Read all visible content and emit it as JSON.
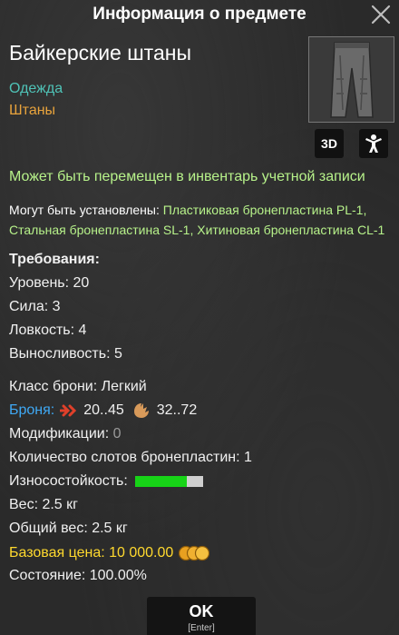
{
  "window": {
    "title": "Информация о предмете"
  },
  "item": {
    "name": "Байкерские штаны",
    "category": "Одежда",
    "subcategory": "Штаны",
    "thumbnail_icon": "pants-icon"
  },
  "buttons": {
    "view_3d": "3D",
    "ok": "OK",
    "ok_hint": "[Enter]"
  },
  "transfer_note": "Может быть перемещен в инвентарь учетной записи",
  "install": {
    "label": "Могут быть установлены: ",
    "values": "Пластиковая бронепластина PL-1, Стальная бронепластина SL-1, Хитиновая бронепластина CL-1"
  },
  "requirements": {
    "header": "Требования:",
    "level": "Уровень: 20",
    "strength": "Сила: 3",
    "agility": "Ловкость: 4",
    "endurance": "Выносливость: 5"
  },
  "stats": {
    "armor_class": "Класс брони: Легкий",
    "armor_label": "Броня:",
    "armor_bullet": "20..45",
    "armor_claw": "32..72",
    "mods_label": "Модификации: ",
    "mods_value": "0",
    "plate_slots": "Количество слотов бронепластин: 1",
    "durability_label": "Износостойкость:",
    "durability_fraction": 0.75,
    "weight": "Вес: 2.5 кг",
    "total_weight": "Общий вес: 2.5 кг",
    "base_price": "Базовая цена: 10 000.00",
    "condition": "Состояние: 100.00%"
  },
  "colors": {
    "category": "#4fc3b7",
    "subcategory": "#e8a33c",
    "transfer": "#b7f28a",
    "armor_label": "#3fa9f5",
    "price": "#ffd92e",
    "durability_fill": "#17d317"
  }
}
